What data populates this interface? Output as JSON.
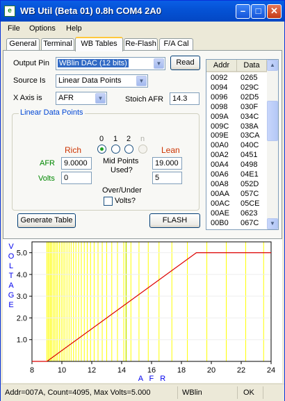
{
  "window": {
    "title": "WB Util (Beta 01) 0.8h  COM4  2A0",
    "icon_text": "e",
    "minimize_icon": "minimize-icon",
    "maximize_icon": "maximize-icon",
    "close_icon": "close-icon"
  },
  "menu": [
    "File",
    "Options",
    "Help"
  ],
  "tabs": [
    {
      "label": "General"
    },
    {
      "label": "Terminal"
    },
    {
      "label": "WB Tables",
      "active": true
    },
    {
      "label": "Re-Flash"
    },
    {
      "label": "F/A Cal"
    }
  ],
  "form": {
    "output_pin_label": "Output Pin",
    "output_pin_value": "WBlin DAC (12 bits)",
    "read_button": "Read",
    "source_label": "Source Is",
    "source_value": "Linear Data Points",
    "xaxis_label": "X Axis is",
    "xaxis_value": "AFR",
    "stoich_label": "Stoich AFR",
    "stoich_value": "14.3"
  },
  "linear_points": {
    "title": "Linear Data Points",
    "radio_labels": [
      "0",
      "1",
      "2",
      "n"
    ],
    "selected_radio": "0",
    "rich_label": "Rich",
    "lean_label": "Lean",
    "afr_label": "AFR",
    "volts_label": "Volts",
    "rich_afr": "9.0000",
    "rich_volts": "0",
    "lean_afr": "19.000",
    "lean_volts": "5",
    "mid_points_line1": "Mid Points",
    "mid_points_line2": "Used?",
    "over_under_label": "Over/Under",
    "volts_check_label": "Volts?",
    "volts_checked": false
  },
  "buttons": {
    "generate": "Generate Table",
    "flash": "FLASH"
  },
  "table": {
    "headers": [
      "Addr",
      "Data"
    ],
    "rows": [
      [
        "0092",
        "0265"
      ],
      [
        "0094",
        "029C"
      ],
      [
        "0096",
        "02D5"
      ],
      [
        "0098",
        "030F"
      ],
      [
        "009A",
        "034C"
      ],
      [
        "009C",
        "038A"
      ],
      [
        "009E",
        "03CA"
      ],
      [
        "00A0",
        "040C"
      ],
      [
        "00A2",
        "0451"
      ],
      [
        "00A4",
        "0498"
      ],
      [
        "00A6",
        "04E1"
      ],
      [
        "00A8",
        "052D"
      ],
      [
        "00AA",
        "057C"
      ],
      [
        "00AC",
        "05CE"
      ],
      [
        "00AE",
        "0623"
      ],
      [
        "00B0",
        "067C"
      ]
    ]
  },
  "chart_data": {
    "type": "line",
    "title": "",
    "xlabel": "A F R",
    "ylabel": "VOLTAGE",
    "xlim": [
      8,
      24
    ],
    "ylim": [
      0,
      5.5
    ],
    "xticks": [
      8,
      10,
      12,
      14,
      16,
      18,
      20,
      22,
      24
    ],
    "yticks": [
      1.0,
      2.0,
      3.0,
      4.0,
      5.0
    ],
    "grid_vertical_afr": [
      9.0,
      9.08,
      9.16,
      9.24,
      9.32,
      9.42,
      9.52,
      9.62,
      9.72,
      9.84,
      9.96,
      10.08,
      10.2,
      10.34,
      10.48,
      10.62,
      10.78,
      10.94,
      11.12,
      11.3,
      11.5,
      11.7,
      11.92,
      12.16,
      12.42,
      12.7,
      13.0,
      13.34,
      13.72,
      14.14,
      14.3,
      14.62,
      15.16,
      15.78,
      16.5,
      17.36,
      18.4,
      19.7,
      21.0,
      22.3,
      23.5
    ],
    "grid_color": "#ffff00",
    "stoich_line_color": "#c8e800",
    "series": [
      {
        "color": "#dd0000",
        "x": [
          8,
          9,
          19,
          24
        ],
        "y": [
          0,
          0,
          5,
          5
        ]
      }
    ]
  },
  "status": {
    "info": "Addr=007A, Count=4095, Max Volts=5.000",
    "mode": "WBlin",
    "state": "OK"
  },
  "colors": {
    "title_bar": "#0553d6",
    "group_title": "#0046d5",
    "rich_lean": "#cc3300",
    "afr_volts": "#008800",
    "axis_label": "#0000ee",
    "plot_line": "#dd0000"
  }
}
